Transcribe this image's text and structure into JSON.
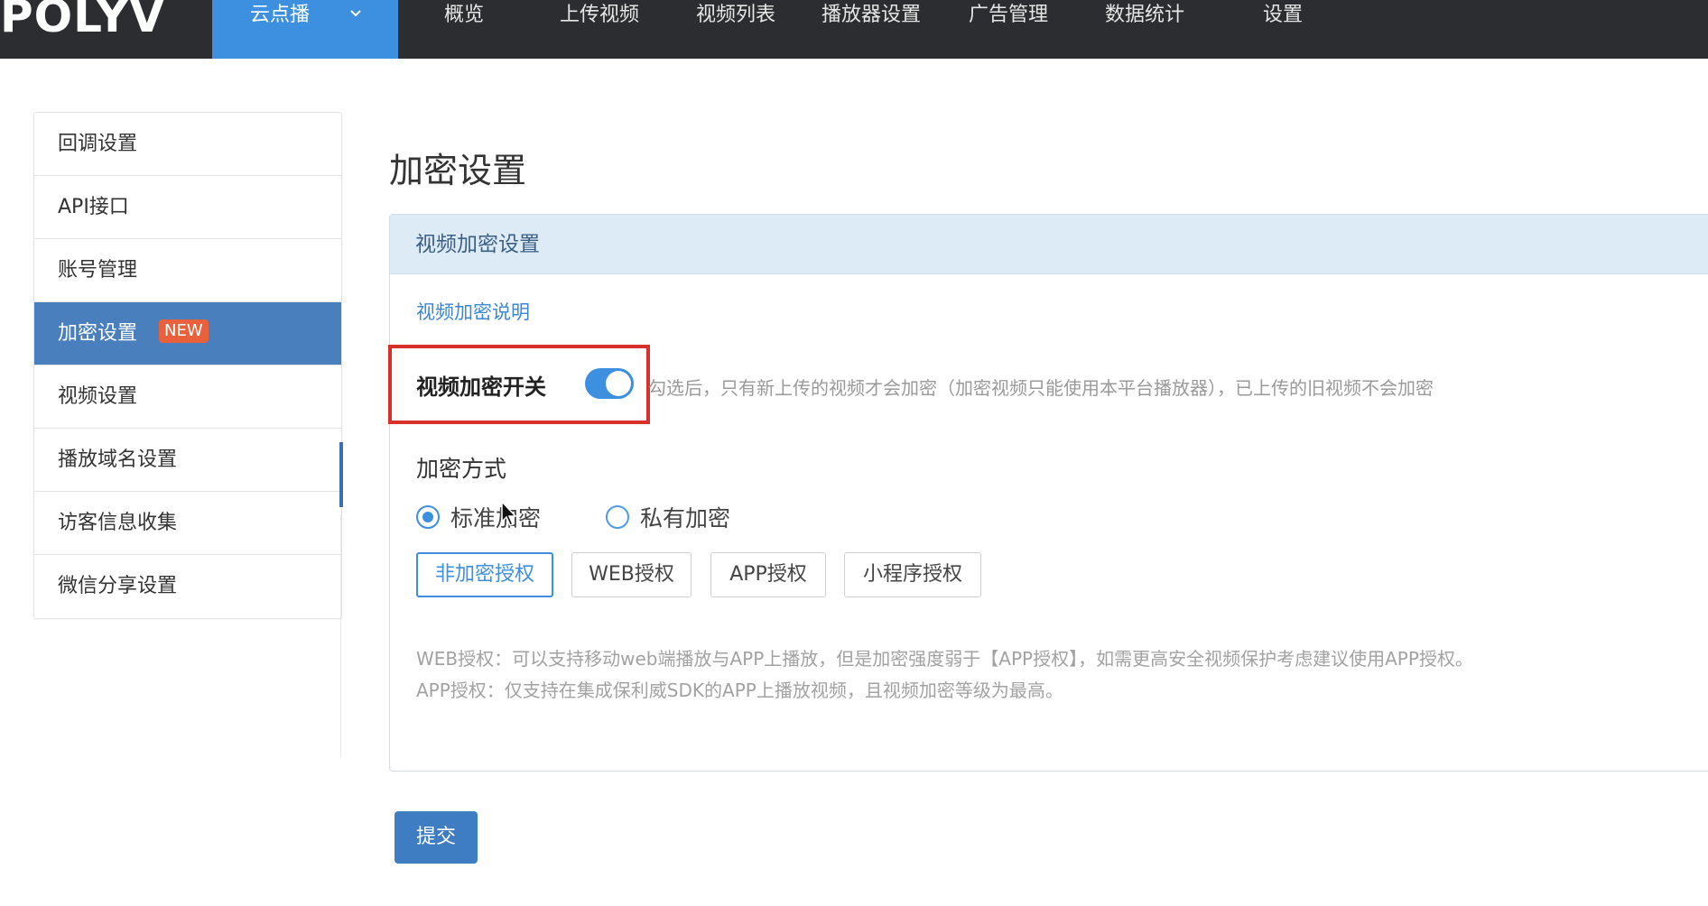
{
  "topbar": {
    "logo_text": "POLYV",
    "active_menu": "云点播",
    "items": [
      "概览",
      "上传视频",
      "视频列表",
      "播放器设置",
      "广告管理",
      "数据统计",
      "设置"
    ]
  },
  "sidebar": {
    "items": [
      {
        "label": "回调设置"
      },
      {
        "label": "API接口"
      },
      {
        "label": "账号管理"
      },
      {
        "label": "加密设置",
        "badge": "NEW"
      },
      {
        "label": "视频设置"
      },
      {
        "label": "播放域名设置"
      },
      {
        "label": "访客信息收集"
      },
      {
        "label": "微信分享设置"
      }
    ]
  },
  "main": {
    "title": "加密设置",
    "panel_title": "视频加密设置",
    "help_link": "视频加密说明",
    "switch": {
      "label": "视频加密开关",
      "on": true,
      "note": "勾选后，只有新上传的视频才会加密（加密视频只能使用本平台播放器），已上传的旧视频不会加密"
    },
    "method": {
      "title": "加密方式",
      "options": [
        {
          "label": "标准加密",
          "selected": true
        },
        {
          "label": "私有加密",
          "selected": false
        }
      ]
    },
    "auth_buttons": [
      {
        "label": "非加密授权",
        "selected": true
      },
      {
        "label": "WEB授权",
        "selected": false
      },
      {
        "label": "APP授权",
        "selected": false
      },
      {
        "label": "小程序授权",
        "selected": false
      }
    ],
    "descriptions": [
      "WEB授权：可以支持移动web端播放与APP上播放，但是加密强度弱于【APP授权】，如需更高安全视频保护考虑建议使用APP授权。",
      "APP授权：仅支持在集成保利威SDK的APP上播放视频，且视频加密等级为最高。"
    ],
    "submit_label": "提交"
  },
  "colors": {
    "topbar_bg": "#2b2d31",
    "accent": "#3d8fe0",
    "sidebar_active": "#4a7fbd",
    "highlight_border": "#d9302a",
    "badge": "#e8603c"
  }
}
